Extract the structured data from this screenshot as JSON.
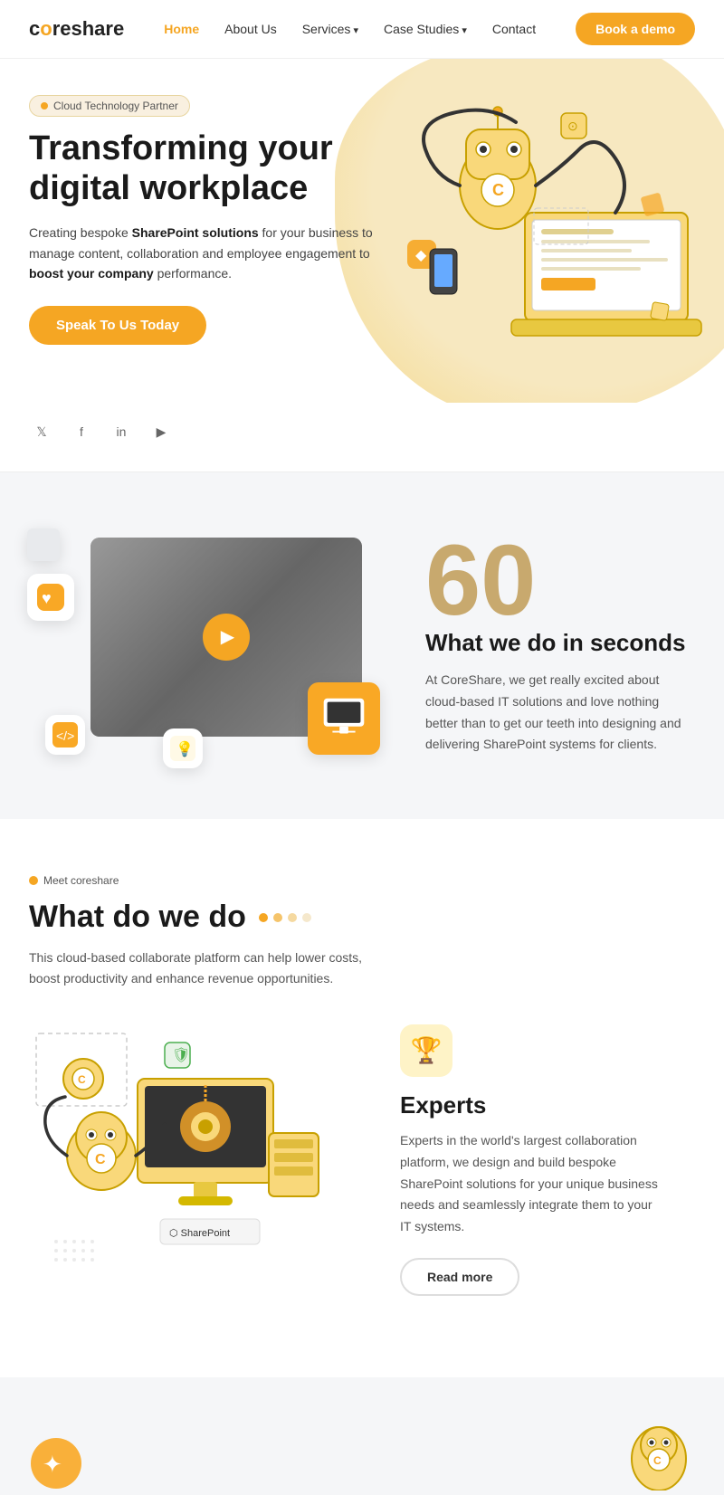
{
  "nav": {
    "logo_core": "core",
    "logo_share": "share",
    "links": [
      {
        "label": "Home",
        "active": true,
        "has_arrow": false
      },
      {
        "label": "About Us",
        "active": false,
        "has_arrow": false
      },
      {
        "label": "Services",
        "active": false,
        "has_arrow": true
      },
      {
        "label": "Case Studies",
        "active": false,
        "has_arrow": true
      },
      {
        "label": "Contact",
        "active": false,
        "has_arrow": false
      }
    ],
    "cta_label": "Book a demo"
  },
  "hero": {
    "badge": "Cloud Technology Partner",
    "heading_line1": "Transforming your",
    "heading_line2": "digital workplace",
    "description": "Creating bespoke SharePoint solutions for your business to manage content, collaboration and employee engagement to boost your company performance.",
    "description_bold1": "SharePoint solutions",
    "description_bold2": "boost your company",
    "cta": "Speak To Us Today"
  },
  "social": {
    "icons": [
      "𝕏",
      "f",
      "in",
      "▶"
    ]
  },
  "video_section": {
    "big_number": "60",
    "heading": "What we do in seconds",
    "description": "At CoreShare, we get really excited about cloud-based IT solutions and love nothing better than to get our teeth into designing and delivering SharePoint systems for clients."
  },
  "what_section": {
    "badge": "Meet coreshare",
    "heading": "What do we do",
    "description": "This cloud-based collaborate platform can help lower costs, boost productivity and enhance revenue opportunities."
  },
  "experts": {
    "badge_icon": "🏆",
    "heading": "Experts",
    "description": "Experts in the world's largest collaboration platform, we design and build bespoke SharePoint solutions for your unique business needs and seamlessly integrate them to your IT systems.",
    "cta": "Read more"
  },
  "colors": {
    "primary": "#f5a623",
    "dark": "#1a1a1a",
    "muted": "#555",
    "light_bg": "#f5f6f8",
    "hero_bg": "#f7e8c0"
  }
}
